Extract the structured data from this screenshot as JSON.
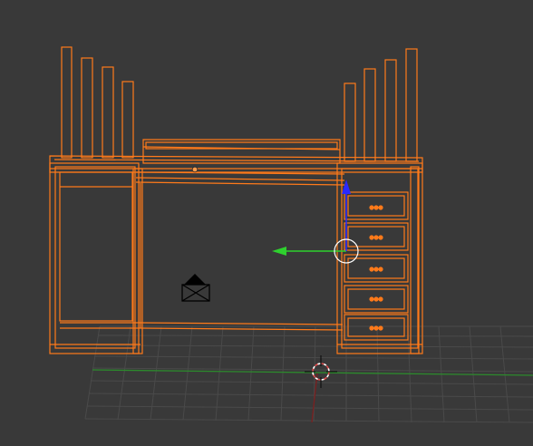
{
  "viewport": {
    "background": "#393939",
    "colors": {
      "wireframe_selected": "#ff7a1a",
      "wireframe_dark": "#e86a10",
      "grid": "#4a4a4a",
      "axis_x": "#7a1f1f",
      "axis_y": "#2c8a2c",
      "manipulator_y": "#2ed12e",
      "manipulator_z": "#2a2aff",
      "cursor": "#e14a4a",
      "lamp": "#000000",
      "origin": "#ff9d4d"
    },
    "icons": {
      "cursor": "3d-cursor-icon",
      "lamp": "lamp-icon",
      "manipulator": "transform-manipulator-icon"
    }
  }
}
